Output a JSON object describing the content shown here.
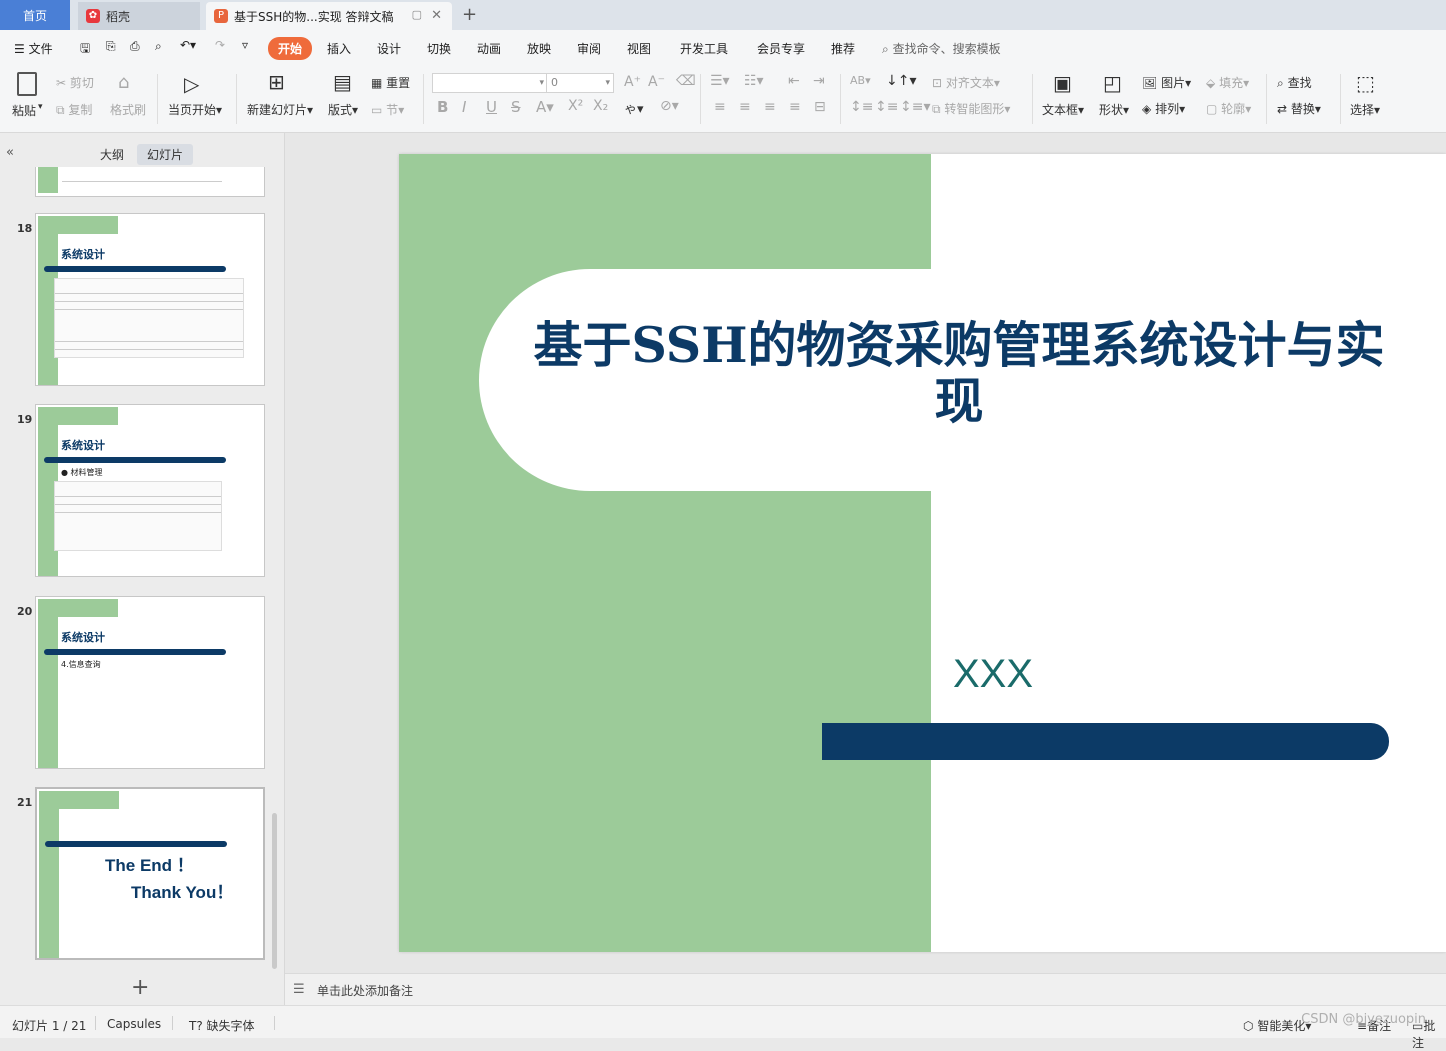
{
  "tabs": {
    "home": "首页",
    "daoke": "稻壳",
    "doc": "基于SSH的物...实现 答辩文稿",
    "add": "+"
  },
  "menu": {
    "file": "文件",
    "start": "开始",
    "insert": "插入",
    "design": "设计",
    "switch": "切换",
    "animation": "动画",
    "play": "放映",
    "review": "审阅",
    "view": "视图",
    "devtools": "开发工具",
    "member": "会员专享",
    "recommend": "推荐",
    "search": "查找命令、搜索模板"
  },
  "ribbon": {
    "paste": "粘贴",
    "cut": "剪切",
    "copy": "复制",
    "format_painter": "格式刷",
    "from_current": "当页开始",
    "new_slide": "新建幻灯片",
    "layout": "版式",
    "reset": "重置",
    "section": "节",
    "font_size": "0",
    "align_text": "对齐文本",
    "smart_shape": "转智能图形",
    "textbox": "文本框",
    "shape": "形状",
    "picture": "图片",
    "arrange": "排列",
    "fill": "填充",
    "outline": "轮廓",
    "find": "查找",
    "replace": "替换",
    "select": "选择"
  },
  "left_panel": {
    "outline_tab": "大纲",
    "slides_tab": "幻灯片",
    "thumbs": [
      {
        "num": "18",
        "title": "系统设计",
        "sub": ""
      },
      {
        "num": "19",
        "title": "系统设计",
        "sub": "● 材料管理"
      },
      {
        "num": "20",
        "title": "系统设计",
        "sub": "4.信息查询"
      },
      {
        "num": "21",
        "title": "",
        "sub": "",
        "end1": "The   End ！",
        "end2": "Thank You！"
      }
    ],
    "add_slide": "+"
  },
  "slide": {
    "title": "基于SSH的物资采购管理系统设计与实现",
    "author": "XXX"
  },
  "notes": {
    "placeholder": "单击此处添加备注"
  },
  "status": {
    "slide_count": "幻灯片 1 / 21",
    "theme": "Capsules",
    "missing_font": "缺失字体",
    "beautify": "智能美化",
    "notes": "备注",
    "comment": "批注",
    "watermark": "CSDN @biyezuopin"
  },
  "colors": {
    "accent": "#ef6b3b",
    "slide_green": "#9ccb99",
    "slide_navy": "#0c3a66",
    "author_teal": "#1a6b6a"
  }
}
